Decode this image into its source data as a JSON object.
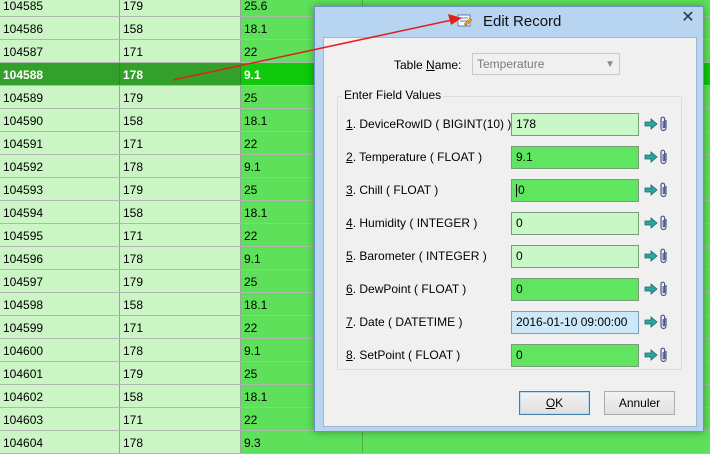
{
  "grid": {
    "rows": [
      {
        "id": "104585",
        "device": "179",
        "temp": "25.6"
      },
      {
        "id": "104586",
        "device": "158",
        "temp": "18.1"
      },
      {
        "id": "104587",
        "device": "171",
        "temp": "22"
      },
      {
        "id": "104588",
        "device": "178",
        "temp": "9.1",
        "selected": true
      },
      {
        "id": "104589",
        "device": "179",
        "temp": "25"
      },
      {
        "id": "104590",
        "device": "158",
        "temp": "18.1"
      },
      {
        "id": "104591",
        "device": "171",
        "temp": "22"
      },
      {
        "id": "104592",
        "device": "178",
        "temp": "9.1"
      },
      {
        "id": "104593",
        "device": "179",
        "temp": "25"
      },
      {
        "id": "104594",
        "device": "158",
        "temp": "18.1"
      },
      {
        "id": "104595",
        "device": "171",
        "temp": "22"
      },
      {
        "id": "104596",
        "device": "178",
        "temp": "9.1"
      },
      {
        "id": "104597",
        "device": "179",
        "temp": "25"
      },
      {
        "id": "104598",
        "device": "158",
        "temp": "18.1"
      },
      {
        "id": "104599",
        "device": "171",
        "temp": "22"
      },
      {
        "id": "104600",
        "device": "178",
        "temp": "9.1"
      },
      {
        "id": "104601",
        "device": "179",
        "temp": "25"
      },
      {
        "id": "104602",
        "device": "158",
        "temp": "18.1"
      },
      {
        "id": "104603",
        "device": "171",
        "temp": "22"
      },
      {
        "id": "104604",
        "device": "178",
        "temp": "9.3"
      }
    ]
  },
  "dialog": {
    "title": "Edit Record",
    "close_glyph": "✕",
    "table_name_label_pre": "Table ",
    "table_name_label_accel": "N",
    "table_name_label_post": "ame:",
    "table_name_value": "Temperature",
    "caret_glyph": "▼",
    "fields_legend": "Enter Field Values",
    "fields": [
      {
        "num": "1",
        "label": ". DeviceRowID ( BIGINT(10) )",
        "value": "178",
        "style": "light"
      },
      {
        "num": "2",
        "label": ". Temperature ( FLOAT )",
        "value": "9.1",
        "style": "green"
      },
      {
        "num": "3",
        "label": ". Chill ( FLOAT )",
        "value": "0",
        "style": "green",
        "focused": true
      },
      {
        "num": "4",
        "label": ". Humidity ( INTEGER )",
        "value": "0",
        "style": "light"
      },
      {
        "num": "5",
        "label": ". Barometer ( INTEGER )",
        "value": "0",
        "style": "light"
      },
      {
        "num": "6",
        "label": ". DewPoint ( FLOAT )",
        "value": "0",
        "style": "green"
      },
      {
        "num": "7",
        "label": ". Date ( DATETIME )",
        "value": "2016-01-10 09:00:00",
        "style": "date"
      },
      {
        "num": "8",
        "label": ". SetPoint ( FLOAT )",
        "value": "0",
        "style": "green"
      }
    ],
    "ok_accel": "O",
    "ok_rest": "K",
    "cancel_label": "Annuler"
  },
  "colors": {
    "grid_light": "#cbf5c4",
    "grid_green": "#5ee05a",
    "selected_row": "#33a02c",
    "pointer_line": "#e0201a"
  }
}
